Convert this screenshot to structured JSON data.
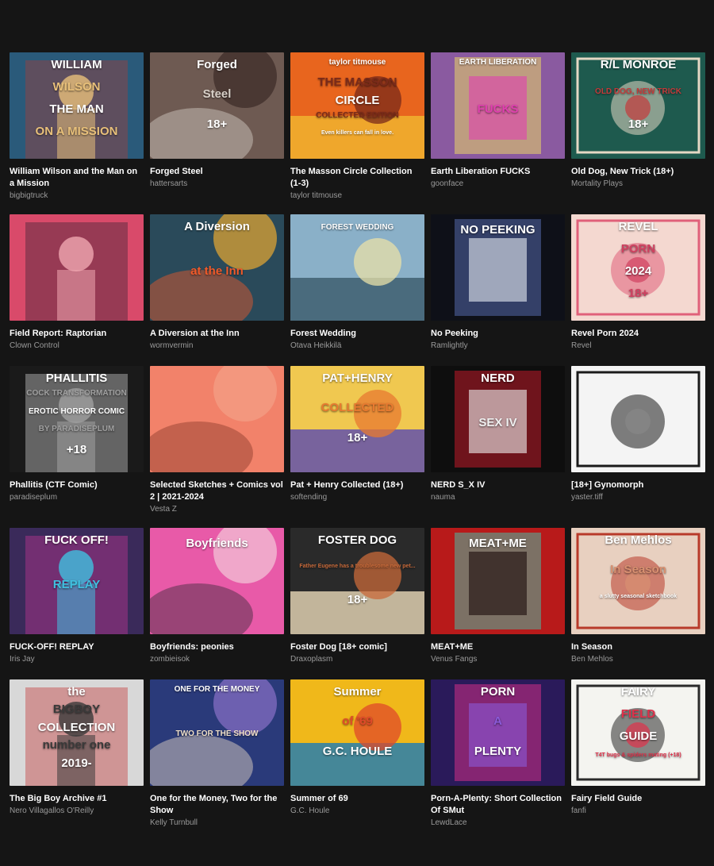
{
  "games": [
    {
      "title": "William Wilson and the Man on a Mission",
      "author": "bigbigtruck",
      "cover_text": [
        "WILLIAM",
        "WILSON",
        "THE MAN",
        "ON A MISSION"
      ],
      "colors": [
        "#2a5a7a",
        "#c0392b",
        "#e8c07a"
      ]
    },
    {
      "title": "Forged Steel",
      "author": "hattersarts",
      "cover_text": [
        "Forged",
        "Steel",
        "18+"
      ],
      "colors": [
        "#6e5a52",
        "#3a2a26",
        "#d8d0c8"
      ]
    },
    {
      "title": "The Masson Circle Collection (1-3)",
      "author": "taylor titmouse",
      "cover_text": [
        "taylor titmouse",
        "THE MASSON",
        "CIRCLE",
        "COLLECTED EDITION",
        "Even killers can fall in love."
      ],
      "colors": [
        "#e8651e",
        "#f0b830",
        "#7a2a1a"
      ]
    },
    {
      "title": "Earth Liberation FUCKS",
      "author": "goonface",
      "cover_text": [
        "EARTH LIBERATION",
        "FUCKS"
      ],
      "colors": [
        "#8a5aa0",
        "#f2e060",
        "#e040b0"
      ]
    },
    {
      "title": "Old Dog, New Trick (18+)",
      "author": "Mortality Plays",
      "cover_text": [
        "R/L MONROE",
        "OLD DOG, NEW TRICK",
        "18+"
      ],
      "colors": [
        "#1e5a4e",
        "#e4d8c4",
        "#c43a3a"
      ]
    },
    {
      "title": "Field Report: Raptorian",
      "author": "Clown Control",
      "cover_text": [],
      "colors": [
        "#d94a6a",
        "#1e1e2a",
        "#f0a8b0"
      ]
    },
    {
      "title": "A Diversion at the Inn",
      "author": "wormvermin",
      "cover_text": [
        "A Diversion",
        "at the Inn"
      ],
      "colors": [
        "#2a4a5a",
        "#e8a830",
        "#f05a2a"
      ]
    },
    {
      "title": "Forest Wedding",
      "author": "Otava Heikkilä",
      "cover_text": [
        "FOREST WEDDING"
      ],
      "colors": [
        "#8ab0c8",
        "#3a5a6a",
        "#e8e0a8"
      ]
    },
    {
      "title": "No Peeking",
      "author": "Ramlightly",
      "cover_text": [
        "NO PEEKING"
      ],
      "colors": [
        "#0e1018",
        "#5a70b8",
        "#e8ecf4"
      ]
    },
    {
      "title": "Revel Porn 2024",
      "author": "Revel",
      "cover_text": [
        "REVEL",
        "PORN",
        "2024",
        "18+"
      ],
      "colors": [
        "#f4d8d0",
        "#e0607a",
        "#d04060"
      ]
    },
    {
      "title": "Phallitis (CTF Comic)",
      "author": "paradiseplum",
      "cover_text": [
        "PHALLITIS",
        "COCK TRANSFORMATION",
        "EROTIC HORROR COMIC",
        "BY PARADISEPLUM",
        "+18"
      ],
      "colors": [
        "#1a1a1a",
        "#f0f0f0",
        "#a0a0a0"
      ]
    },
    {
      "title": "Selected Sketches + Comics vol 2 | 2021-2024",
      "author": "Vesta Z",
      "cover_text": [],
      "colors": [
        "#f2826a",
        "#f4a088",
        "#8a3a2a"
      ]
    },
    {
      "title": "Pat + Henry Collected (18+)",
      "author": "softending",
      "cover_text": [
        "PAT+HENRY",
        "COLLECTED",
        "18+"
      ],
      "colors": [
        "#f0c850",
        "#5a4ab0",
        "#e87a30"
      ]
    },
    {
      "title": "NERD S_X IV",
      "author": "nauma",
      "cover_text": [
        "NERD",
        "SEX IV"
      ],
      "colors": [
        "#0e0e0e",
        "#d01a2a",
        "#f0f0f0"
      ]
    },
    {
      "title": "[18+] Gynomorph",
      "author": "yaster.tiff",
      "cover_text": [],
      "colors": [
        "#f4f4f4",
        "#1a1a1a",
        "#888888"
      ]
    },
    {
      "title": "FUCK-OFF! REPLAY",
      "author": "Iris Jay",
      "cover_text": [
        "FUCK OFF!",
        "REPLAY"
      ],
      "colors": [
        "#3a2a5a",
        "#e03aa0",
        "#40c0e0"
      ]
    },
    {
      "title": "Boyfriends: peonies",
      "author": "zombieisok",
      "cover_text": [
        "Boyfriends"
      ],
      "colors": [
        "#e85aa8",
        "#f4c8d8",
        "#3a2a3a"
      ]
    },
    {
      "title": "Foster Dog [18+ comic]",
      "author": "Draxoplasm",
      "cover_text": [
        "FOSTER DOG",
        "Father Eugene has a troublesome new pet...",
        "18+"
      ],
      "colors": [
        "#2a2a2a",
        "#e8d8b8",
        "#c86a3a"
      ]
    },
    {
      "title": "MEAT+ME",
      "author": "Venus Fangs",
      "cover_text": [
        "MEAT+ME"
      ],
      "colors": [
        "#b81a1a",
        "#40c8b0",
        "#1a0a0a"
      ]
    },
    {
      "title": "In Season",
      "author": "Ben Mehlos",
      "cover_text": [
        "Ben Mehlos",
        "In Season",
        "a slutty seasonal sketchbook"
      ],
      "colors": [
        "#e8d0c0",
        "#b83a2a",
        "#d89070"
      ]
    },
    {
      "title": "The Big Boy Archive #1",
      "author": "Nero Villagallos O'Reilly",
      "cover_text": [
        "the",
        "BIGBOY",
        "COLLECTION",
        "number one",
        "2019-"
      ],
      "colors": [
        "#d8d8d8",
        "#c01a1a",
        "#3a3a3a"
      ]
    },
    {
      "title": "One for the Money, Two for the Show",
      "author": "Kelly Turnbull",
      "cover_text": [
        "ONE FOR THE MONEY",
        "TWO FOR THE SHOW"
      ],
      "colors": [
        "#2a3a7a",
        "#8a70c8",
        "#f0e0c8"
      ]
    },
    {
      "title": "Summer of 69",
      "author": "G.C. Houle",
      "cover_text": [
        "Summer",
        "of '69",
        "G.C. HOULE"
      ],
      "colors": [
        "#f0b81a",
        "#1a7ab8",
        "#e04a2a"
      ]
    },
    {
      "title": "Porn-A-Plenty: Short Collection Of SMut",
      "author": "LewdLace",
      "cover_text": [
        "PORN",
        "A",
        "PLENTY"
      ],
      "colors": [
        "#2a1a5a",
        "#e0308a",
        "#8a5ad8"
      ]
    },
    {
      "title": "Fairy Field Guide",
      "author": "fanfi",
      "cover_text": [
        "FAIRY",
        "FIELD",
        "GUIDE",
        "T4T bugs & spiders mating (+18)"
      ],
      "colors": [
        "#f4f4f0",
        "#2a2a2a",
        "#e0304a"
      ]
    }
  ]
}
